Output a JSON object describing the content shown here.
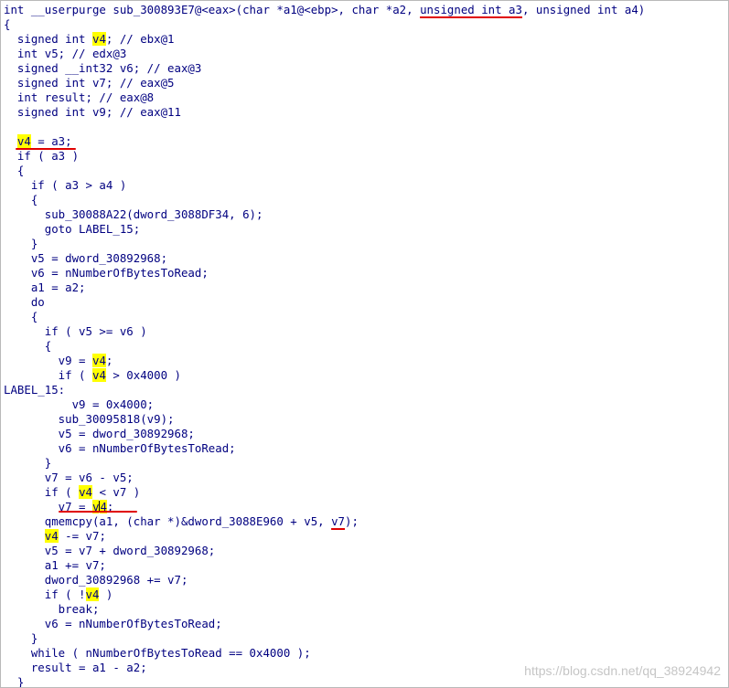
{
  "code_view": {
    "lines": [
      [
        {
          "t": "int __userpurge sub_300893E7@<eax>(char *a1@<ebp>, char *a2, "
        },
        {
          "t": "unsigned int a3",
          "mark": "ul"
        },
        {
          "t": ", unsigned int a4)"
        }
      ],
      [
        {
          "t": "{"
        }
      ],
      [
        {
          "t": "  signed int "
        },
        {
          "t": "v4",
          "mark": "hl"
        },
        {
          "t": "; // ebx@1"
        }
      ],
      [
        {
          "t": "  int v5; // edx@3"
        }
      ],
      [
        {
          "t": "  signed __int32 v6; // eax@3"
        }
      ],
      [
        {
          "t": "  signed int v7; // eax@5"
        }
      ],
      [
        {
          "t": "  int result; // eax@8"
        }
      ],
      [
        {
          "t": "  signed int v9; // eax@11"
        }
      ],
      [
        {
          "t": ""
        }
      ],
      [
        {
          "t": "  "
        },
        {
          "t": "v4",
          "mark": "hl"
        },
        {
          "t": " = a3;"
        }
      ],
      [
        {
          "t": "  if ( a3 )"
        }
      ],
      [
        {
          "t": "  {"
        }
      ],
      [
        {
          "t": "    if ( a3 > a4 )"
        }
      ],
      [
        {
          "t": "    {"
        }
      ],
      [
        {
          "t": "      sub_30088A22(dword_3088DF34, 6);"
        }
      ],
      [
        {
          "t": "      goto LABEL_15;"
        }
      ],
      [
        {
          "t": "    }"
        }
      ],
      [
        {
          "t": "    v5 = dword_30892968;"
        }
      ],
      [
        {
          "t": "    v6 = nNumberOfBytesToRead;"
        }
      ],
      [
        {
          "t": "    a1 = a2;"
        }
      ],
      [
        {
          "t": "    do"
        }
      ],
      [
        {
          "t": "    {"
        }
      ],
      [
        {
          "t": "      if ( v5 >= v6 )"
        }
      ],
      [
        {
          "t": "      {"
        }
      ],
      [
        {
          "t": "        v9 = "
        },
        {
          "t": "v4",
          "mark": "hl"
        },
        {
          "t": ";"
        }
      ],
      [
        {
          "t": "        if ( "
        },
        {
          "t": "v4",
          "mark": "hl"
        },
        {
          "t": " > 0x4000 )"
        }
      ],
      [
        {
          "t": "LABEL_15:"
        }
      ],
      [
        {
          "t": "          v9 = 0x4000;"
        }
      ],
      [
        {
          "t": "        sub_30095818(v9);"
        }
      ],
      [
        {
          "t": "        v5 = dword_30892968;"
        }
      ],
      [
        {
          "t": "        v6 = nNumberOfBytesToRead;"
        }
      ],
      [
        {
          "t": "      }"
        }
      ],
      [
        {
          "t": "      v7 = v6 - v5;"
        }
      ],
      [
        {
          "t": "      if ( "
        },
        {
          "t": "v4",
          "mark": "hl"
        },
        {
          "t": " < v7 )"
        }
      ],
      [
        {
          "t": "        v7 = "
        },
        {
          "t": "v",
          "mark": "hl"
        },
        {
          "t": "",
          "mark": "caret"
        },
        {
          "t": "4",
          "mark": "hl"
        },
        {
          "t": ";"
        }
      ],
      [
        {
          "t": "      qmemcpy(a1, (char *)&dword_3088E960 + v5, "
        },
        {
          "t": "v7",
          "mark": "ul"
        },
        {
          "t": ");"
        }
      ],
      [
        {
          "t": "      "
        },
        {
          "t": "v4",
          "mark": "hl"
        },
        {
          "t": " -= v7;"
        }
      ],
      [
        {
          "t": "      v5 = v7 + dword_30892968;"
        }
      ],
      [
        {
          "t": "      a1 += v7;"
        }
      ],
      [
        {
          "t": "      dword_30892968 += v7;"
        }
      ],
      [
        {
          "t": "      if ( !"
        },
        {
          "t": "v4",
          "mark": "hl"
        },
        {
          "t": " )"
        }
      ],
      [
        {
          "t": "        break;"
        }
      ],
      [
        {
          "t": "      v6 = nNumberOfBytesToRead;"
        }
      ],
      [
        {
          "t": "    }"
        }
      ],
      [
        {
          "t": "    while ( nNumberOfBytesToRead == 0x4000 );"
        }
      ],
      [
        {
          "t": "    result = a1 - a2;"
        }
      ],
      [
        {
          "t": "  }"
        }
      ]
    ]
  },
  "watermark": "https://blog.csdn.net/qq_38924942"
}
